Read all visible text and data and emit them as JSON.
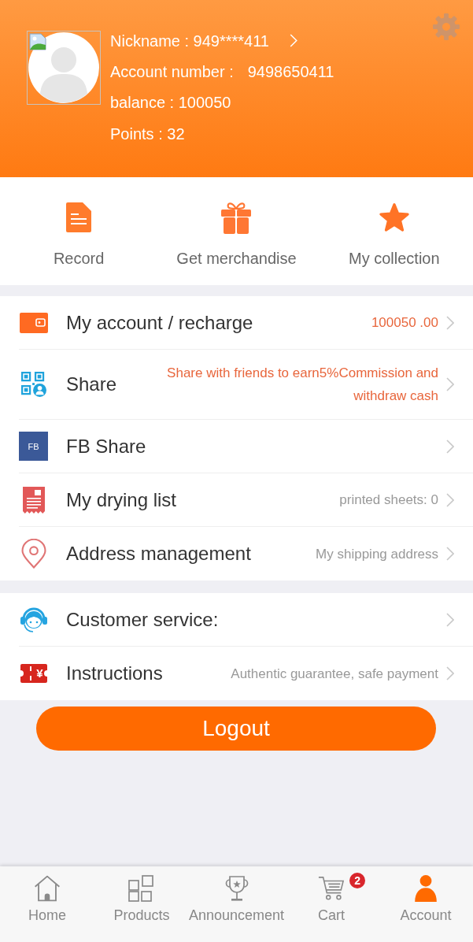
{
  "header": {
    "nickname": "Nickname : 949****411",
    "account_number_label": "Account number :",
    "account_number": "9498650411",
    "balance": "balance : 100050",
    "points": "Points : 32"
  },
  "quick_links": [
    {
      "kind": "document",
      "label": "Record"
    },
    {
      "kind": "gift",
      "label": "Get merchandise"
    },
    {
      "kind": "star",
      "label": "My collection"
    }
  ],
  "menu_groups": [
    {
      "rows": [
        {
          "kind": "wallet",
          "label": "My account / recharge",
          "detail": "100050 .00",
          "detail_highlighted": true
        },
        {
          "kind": "qr_user",
          "label": "Share",
          "detail": "Share with friends to earn5%Commission and withdraw cash",
          "detail_highlighted": true
        },
        {
          "kind": "fb",
          "icon_text": "FB",
          "label": "FB Share"
        },
        {
          "kind": "receipt",
          "label": "My drying list",
          "detail": "printed sheets: 0",
          "detail_highlighted": false
        },
        {
          "kind": "pin",
          "label": "Address management",
          "detail": "My shipping address",
          "detail_highlighted": false
        }
      ]
    },
    {
      "rows": [
        {
          "kind": "headset",
          "label": "Customer service:"
        },
        {
          "kind": "ticket",
          "icon_text": "¥",
          "label": "Instructions",
          "detail": "Authentic guarantee, safe payment",
          "detail_highlighted": false
        }
      ]
    }
  ],
  "logout_button": {
    "label": "Logout"
  },
  "tab_bar": {
    "items": [
      {
        "kind": "home",
        "label": "Home",
        "selected": false
      },
      {
        "kind": "grid",
        "label": "Products",
        "selected": false
      },
      {
        "kind": "trophy",
        "label": "Announcement",
        "selected": false
      },
      {
        "kind": "cart",
        "label": "Cart",
        "badge": "2",
        "selected": false
      },
      {
        "kind": "person",
        "label": "Account",
        "selected": true
      }
    ]
  }
}
